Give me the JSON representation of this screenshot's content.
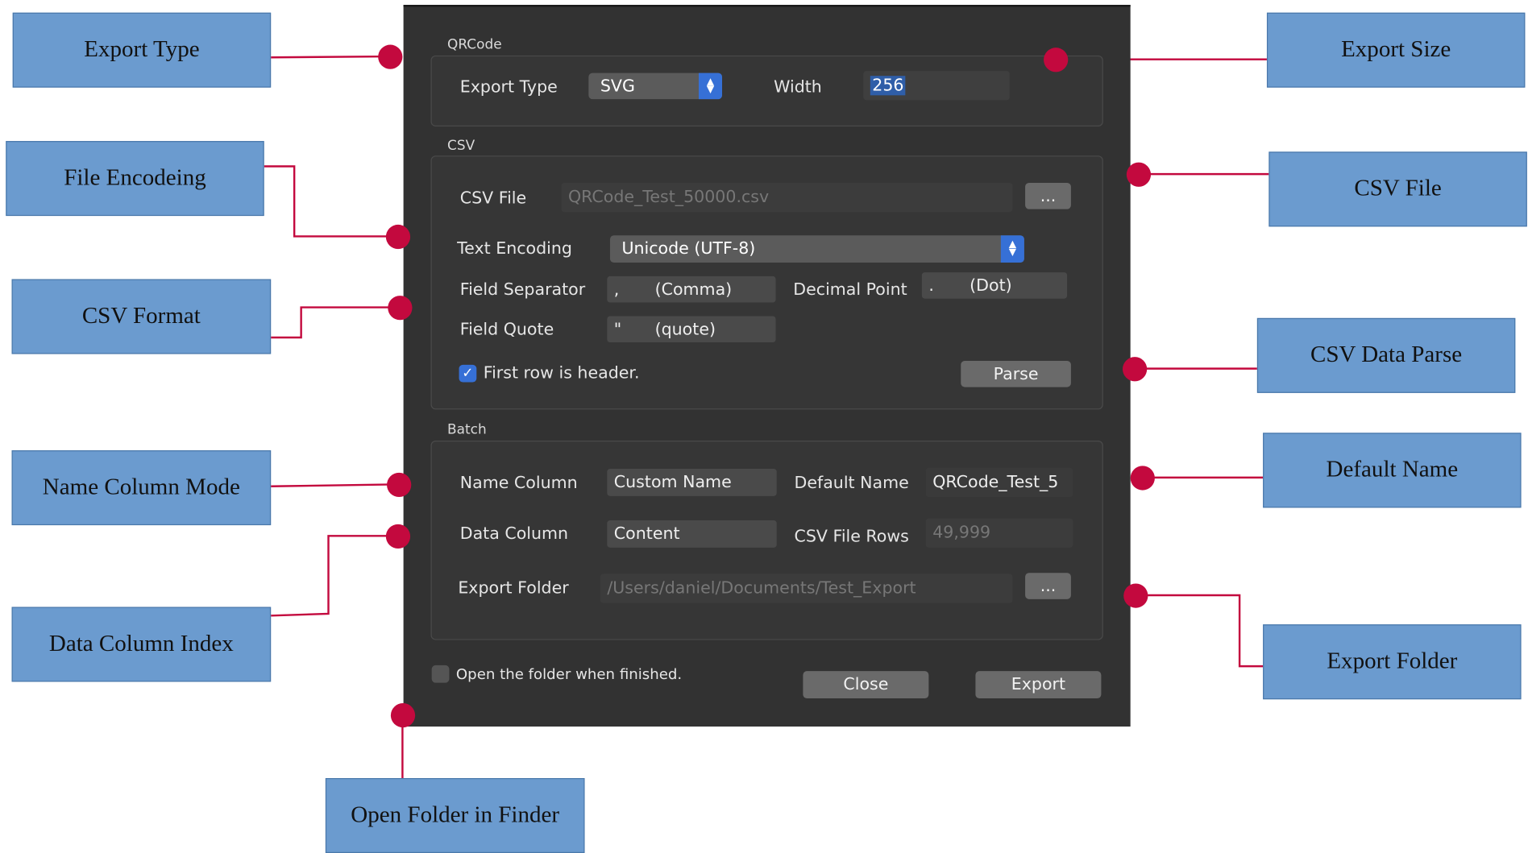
{
  "dialog": {
    "qrcode": {
      "section_title": "QRCode",
      "export_type_label": "Export Type",
      "export_type_value": "SVG",
      "width_label": "Width",
      "width_value": "256"
    },
    "csv": {
      "section_title": "CSV",
      "file_label": "CSV File",
      "file_value": "QRCode_Test_50000.csv",
      "browse_label": "...",
      "encoding_label": "Text Encoding",
      "encoding_value": "Unicode (UTF-8)",
      "field_separator_label": "Field Separator",
      "field_separator_char": ",",
      "field_separator_name": "(Comma)",
      "decimal_point_label": "Decimal Point",
      "decimal_point_char": ".",
      "decimal_point_name": "(Dot)",
      "field_quote_label": "Field Quote",
      "field_quote_char": "\"",
      "field_quote_name": "(quote)",
      "header_checkbox_label": "First row is header.",
      "parse_label": "Parse"
    },
    "batch": {
      "section_title": "Batch",
      "name_column_label": "Name Column",
      "name_column_value": "Custom Name",
      "default_name_label": "Default Name",
      "default_name_value": "QRCode_Test_5",
      "data_column_label": "Data Column",
      "data_column_value": "Content",
      "csv_rows_label": "CSV File Rows",
      "csv_rows_value": "49,999",
      "export_folder_label": "Export Folder",
      "export_folder_value": "/Users/daniel/Documents/Test_Export",
      "browse_label": "..."
    },
    "open_folder_label": "Open the folder when finished.",
    "close_label": "Close",
    "export_label": "Export"
  },
  "annotations": {
    "export_type": "Export Type",
    "file_encoding": "File Encodeing",
    "csv_format": "CSV Format",
    "name_column_mode": "Name Column Mode",
    "data_column_index": "Data Column Index",
    "open_folder": "Open Folder in Finder",
    "export_size": "Export Size",
    "csv_file": "CSV File",
    "csv_data_parse": "CSV Data Parse",
    "default_name": "Default Name",
    "export_folder": "Export Folder"
  },
  "colors": {
    "dialog_bg": "#323232",
    "accent_blue": "#3670d6",
    "annotation_fill": "#6b9bcf",
    "marker_red": "#c3093e"
  }
}
